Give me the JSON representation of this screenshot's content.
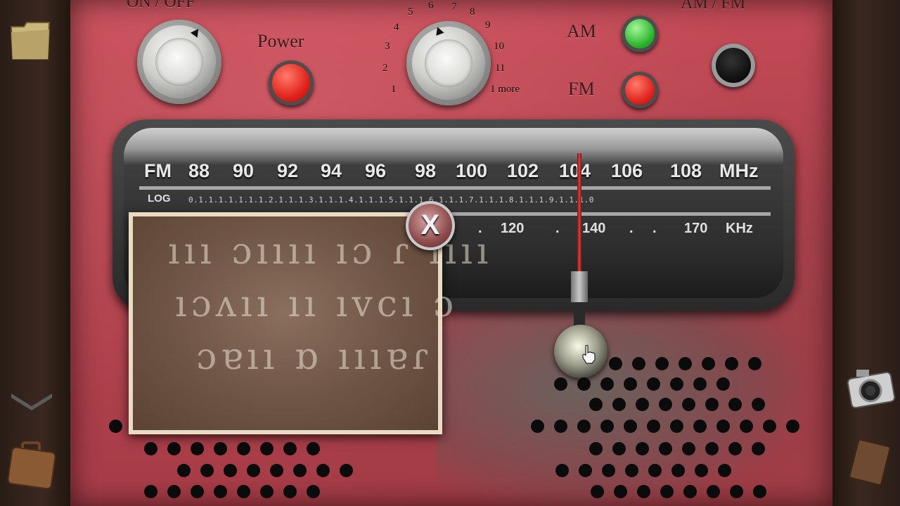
{
  "radio": {
    "on_off_label": "ON / OFF",
    "power_label": "Power",
    "am_fm_label": "AM / FM",
    "am_label": "AM",
    "fm_label": "FM",
    "selector_numbers": [
      "1",
      "2",
      "3",
      "4",
      "5",
      "6",
      "7",
      "8",
      "9",
      "10",
      "11",
      "1 more"
    ]
  },
  "dial": {
    "fm_label": "FM",
    "fm_values": [
      "88",
      "90",
      "92",
      "94",
      "96",
      "98",
      "100",
      "102",
      "104",
      "106",
      "108"
    ],
    "fm_unit": "MHz",
    "log_label": "LOG",
    "log_ticks": "0.1.1.1.1.1.1.1.2.1.1.1.3.1.1.1.4.1.1.1.5.1.1.1.6.1.1.1.7.1.1.1.8.1.1.1.9.1.1.1.0",
    "khz_values": [
      "120",
      "140",
      "170"
    ],
    "khz_unit": "KHz",
    "needle_position_mhz": 104
  },
  "note": {
    "close_label": "X"
  },
  "colors": {
    "panel": "#b2434e",
    "power_button": "#e0201a",
    "am_button": "#28b52a",
    "fm_button": "#e0201a",
    "needle": "#d84040"
  },
  "hud": {
    "left": [
      "folder-icon",
      "chevron-down-icon",
      "briefcase-icon"
    ],
    "right": [
      "camera-icon",
      "journal-icon"
    ]
  }
}
